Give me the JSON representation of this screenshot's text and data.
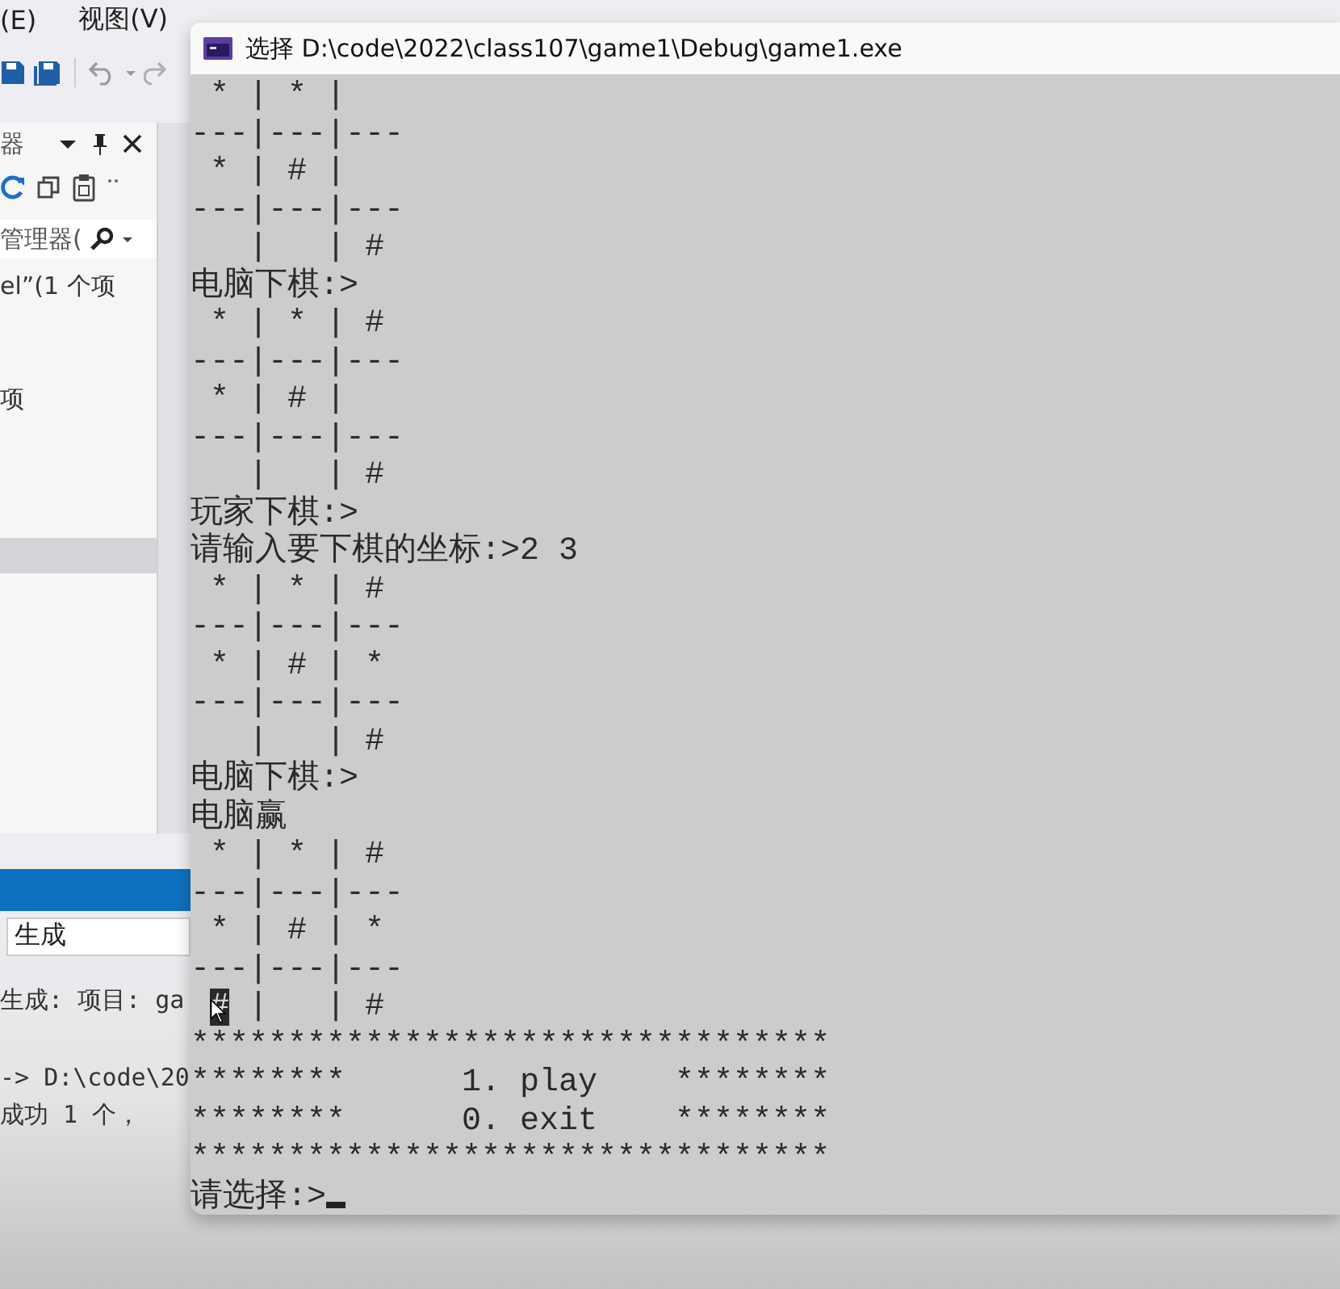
{
  "menu_bar": [
    "(E)",
    "视图(V)"
  ],
  "solution_explorer": {
    "title": "器",
    "search": {
      "placeholder": "管理器("
    },
    "items": [
      "el”(1 个项",
      "项"
    ]
  },
  "output": {
    "source": "生成",
    "lines": [
      "生成: 项目: ga",
      "-> D:\\code\\20",
      "成功 1 个，"
    ]
  },
  "console": {
    "title": "选择 D:\\code\\2022\\class107\\game1\\Debug\\game1.exe",
    "lines": [
      {
        "text": " * | * |"
      },
      {
        "text": "---|---|---"
      },
      {
        "text": " * | # |"
      },
      {
        "text": "---|---|---"
      },
      {
        "text": "   |   | #"
      },
      {
        "text": "电脑下棋:>"
      },
      {
        "text": " * | * | #"
      },
      {
        "text": "---|---|---"
      },
      {
        "text": " * | # |"
      },
      {
        "text": "---|---|---"
      },
      {
        "text": "   |   | #"
      },
      {
        "text": "玩家下棋:>"
      },
      {
        "text": "请输入要下棋的坐标:>2 3"
      },
      {
        "text": " * | * | #"
      },
      {
        "text": "---|---|---"
      },
      {
        "text": " * | # | *"
      },
      {
        "text": "---|---|---"
      },
      {
        "text": "   |   | #"
      },
      {
        "text": "电脑下棋:>"
      },
      {
        "text": "电脑赢"
      },
      {
        "text": " * | * | #"
      },
      {
        "text": "---|---|---"
      },
      {
        "text": " * | # | *"
      },
      {
        "text": "---|---|---"
      },
      {
        "segments": [
          {
            "text": "#",
            "selected": true
          },
          {
            "text": " |   | #",
            "selected": false
          }
        ]
      },
      {
        "text": "*********************************"
      },
      {
        "text": "********      1. play    ********"
      },
      {
        "text": "********      0. exit    ********"
      },
      {
        "text": "*********************************"
      },
      {
        "text": "请选择:>",
        "cursor": true
      }
    ]
  }
}
